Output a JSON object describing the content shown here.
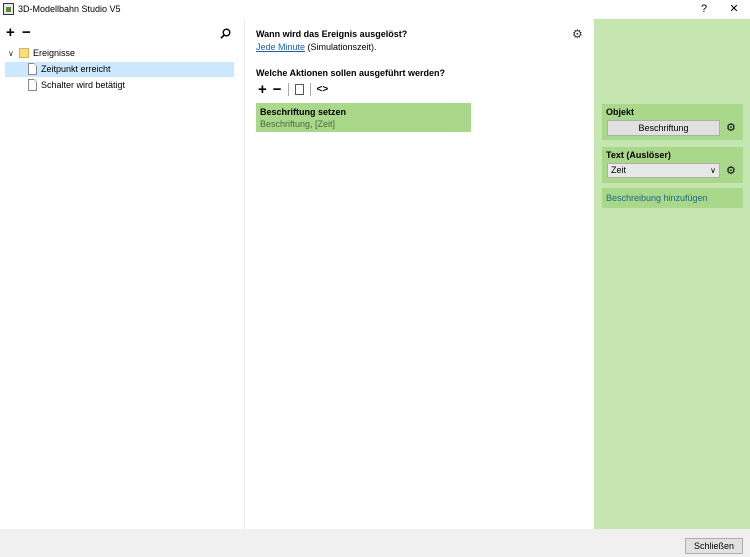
{
  "window": {
    "title": "3D-Modellbahn Studio V5",
    "help_label": "?",
    "close_label": "✕"
  },
  "left": {
    "add_label": "+",
    "remove_label": "−",
    "search_icon": "search-icon",
    "tree": [
      {
        "label": "Ereignisse",
        "type": "folder",
        "expanded": true
      },
      {
        "label": "Zeitpunkt erreicht",
        "type": "event",
        "selected": true
      },
      {
        "label": "Schalter wird betätigt",
        "type": "event",
        "selected": false
      }
    ]
  },
  "center": {
    "trigger_question": "Wann wird das Ereignis ausgelöst?",
    "trigger_link": "Jede Minute",
    "trigger_suffix": " (Simulationszeit).",
    "actions_question": "Welche Aktionen sollen ausgeführt werden?",
    "tools": {
      "add": "+",
      "remove": "−",
      "code": "<>"
    },
    "action": {
      "title": "Beschriftung setzen",
      "subtitle": "Beschriftung, [Zeit]"
    }
  },
  "right": {
    "object_label": "Objekt",
    "object_value": "Beschriftung",
    "text_label": "Text (Auslöser)",
    "text_value": "Zeit",
    "add_description": "Beschreibung hinzufügen"
  },
  "footer": {
    "close_button": "Schließen"
  },
  "colors": {
    "panel_green": "#c6e6b1",
    "card_green": "#a9d88a",
    "selection_blue": "#cce8ff"
  }
}
